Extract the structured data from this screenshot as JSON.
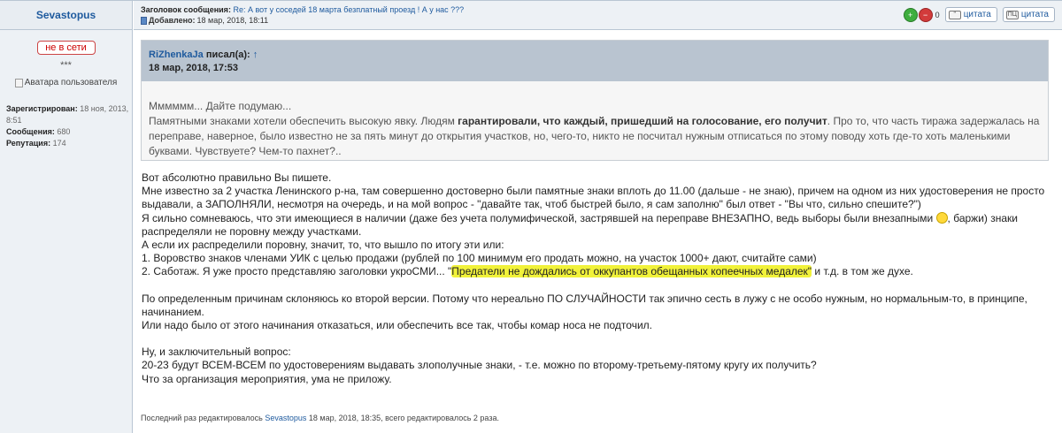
{
  "author": {
    "name": "Sevastopus",
    "status": "не в сети",
    "rank": "***",
    "avatar_alt": "Аватара пользователя",
    "registered_label": "Зарегистрирован:",
    "registered_value": "18 ноя, 2013, 8:51",
    "messages_label": "Сообщения:",
    "messages_value": "680",
    "reputation_label": "Репутация:",
    "reputation_value": "174"
  },
  "header": {
    "subject_label": "Заголовок сообщения:",
    "subject": "Re: А вот у соседей 18 марта безплатный проезд ! А у нас ???",
    "added_label": "Добавлено:",
    "added_value": "18 мар, 2018, 18:11",
    "vote_count": "0",
    "quote1_label": "цитата",
    "quote2_label": "цитата",
    "quote2_icon_text": "ПЦ"
  },
  "quote": {
    "author": "RiZhenkaJa",
    "wrote": "писал(а):",
    "arrow": "↑",
    "date": "18 мар, 2018, 17:53",
    "line1": "Мммммм... Дайте подумаю...",
    "line2_pre": "Памятными знаками хотели обеспечить высокую явку. Людям ",
    "line2_bold": "гарантировали, что каждый, пришедший на голосование, его получит",
    "line2_post": ". Про то, что часть тиража задержалась на переправе, наверное, было известно не за пять минут до открытия участков, но, чего-то, никто не посчитал нужным отписаться по этому поводу хоть где-то хоть маленькими буквами. Чувствуете? Чем-то пахнет?.."
  },
  "message": {
    "p1": "Вот абсолютно правильно Вы пишете.",
    "p2": "Мне известно за 2 участка Ленинского р-на, там совершенно достоверно были памятные знаки вплоть до 11.00 (дальше - не знаю), причем на одном из них удостоверения не просто выдавали, а ЗАПОЛНЯЛИ, несмотря на очередь, и на мой вопрос - \"давайте так, чтоб быстрей было, я сам заполню\" был ответ - \"Вы что, сильно спешите?\")",
    "p3": "Я сильно сомневаюсь, что эти имеющиеся в наличии (даже без учета полумифической, застрявшей на переправе ВНЕЗАПНО, ведь выборы были внезапными",
    "p3_end": ", баржи) знаки распределяли не поровну между участками.",
    "p4": "А если их распределили поровну, значит, то, что вышло по итогу эти или:",
    "p5": "1. Воровство знаков членами УИК с целью продажи (рублей по 100 минимум его продать можно, на участок 1000+ дают, считайте сами)",
    "p6_pre": "2. Саботаж. Я уже просто представляю заголовки укроСМИ... \"",
    "p6_hl": "Предатели не дождались от оккупантов обещанных копеечных медалек\"",
    "p6_post": " и т.д. в том же духе.",
    "p7": "По определенным причинам склоняюсь ко второй версии. Потому что нереально ПО СЛУЧАЙНОСТИ так эпично сесть в лужу с не особо нужным, но нормальным-то, в принципе, начинанием.",
    "p8": "Или надо было от этого начинания отказаться, или обеспечить все так, чтобы комар носа не подточил.",
    "p9": "Ну, и заключительный вопрос:",
    "p10": "20-23 будут ВСЕМ-ВСЕМ по удостоверениям выдавать злополучные знаки, - т.е. можно по второму-третьему-пятому кругу их получить?",
    "p11": "Что за организация мероприятия, ума не приложу."
  },
  "footer": {
    "edited_pre": "Последний раз редактировалось ",
    "edited_user": "Sevastopus",
    "edited_post": " 18 мар, 2018, 18:35, всего редактировалось 2 раза."
  }
}
